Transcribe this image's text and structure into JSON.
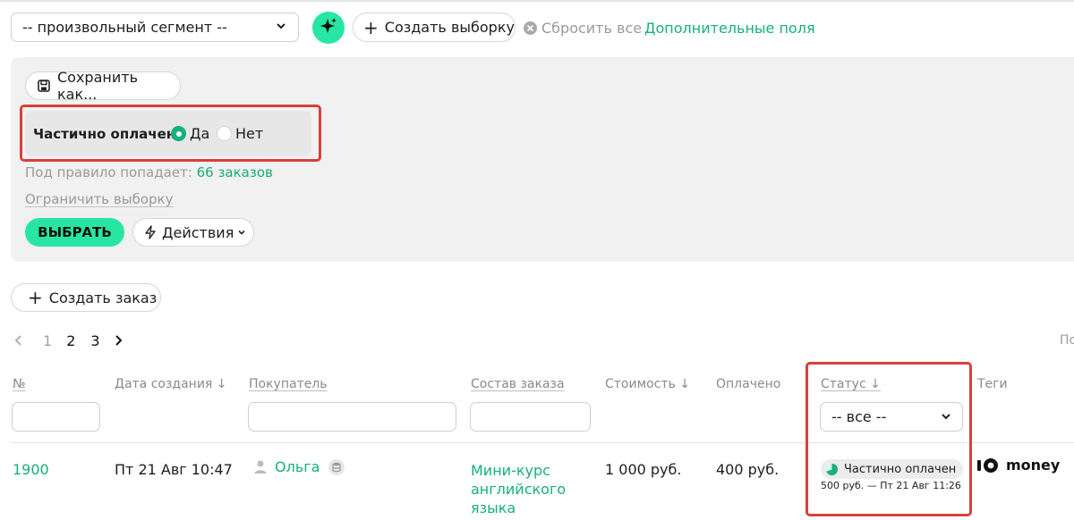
{
  "top": {
    "segment_value": "-- произвольный сегмент --",
    "create_selection_label": "Создать выборку",
    "reset_all_label": "Сбросить все",
    "additional_fields_label": "Дополнительные поля"
  },
  "filter_panel": {
    "save_as_label": "Сохранить как...",
    "filter_label": "Частично оплачен",
    "option_yes": "Да",
    "option_no": "Нет",
    "selected": "Да",
    "rule_prefix": "Под правило попадает:",
    "rule_count": "66 заказов",
    "limit_label": "Ограничить выборку",
    "select_button": "ВЫБРАТЬ",
    "actions_label": "Действия"
  },
  "create_order_label": "Создать заказ",
  "pagination": {
    "pages": [
      "1",
      "2",
      "3"
    ],
    "current": "1",
    "right_cut_text": "По"
  },
  "table": {
    "headers": {
      "number": "№",
      "created": "Дата создания ↓",
      "buyer": "Покупатель",
      "composition": "Состав заказа",
      "cost": "Стоимость ↓",
      "paid": "Оплачено",
      "status": "Статус ↓",
      "tags": "Теги"
    },
    "status_filter_value": "-- все --",
    "rows": [
      {
        "number": "1900",
        "created": "Пт 21 Авг 10:47",
        "buyer": "Ольга",
        "composition_lines": [
          "Мини-курс",
          "английского",
          "языка"
        ],
        "cost": "1 000 руб.",
        "paid": "400 руб.",
        "status": "Частично оплачен",
        "status_detail": "500 руб. — Пт 21 Авг 11:26",
        "tag_logo_text": "money"
      }
    ]
  },
  "colors": {
    "accent_green": "#16b07a",
    "button_green": "#27e6a3",
    "highlight_red": "#d9403a",
    "panel_grey": "#f1f1f1"
  }
}
